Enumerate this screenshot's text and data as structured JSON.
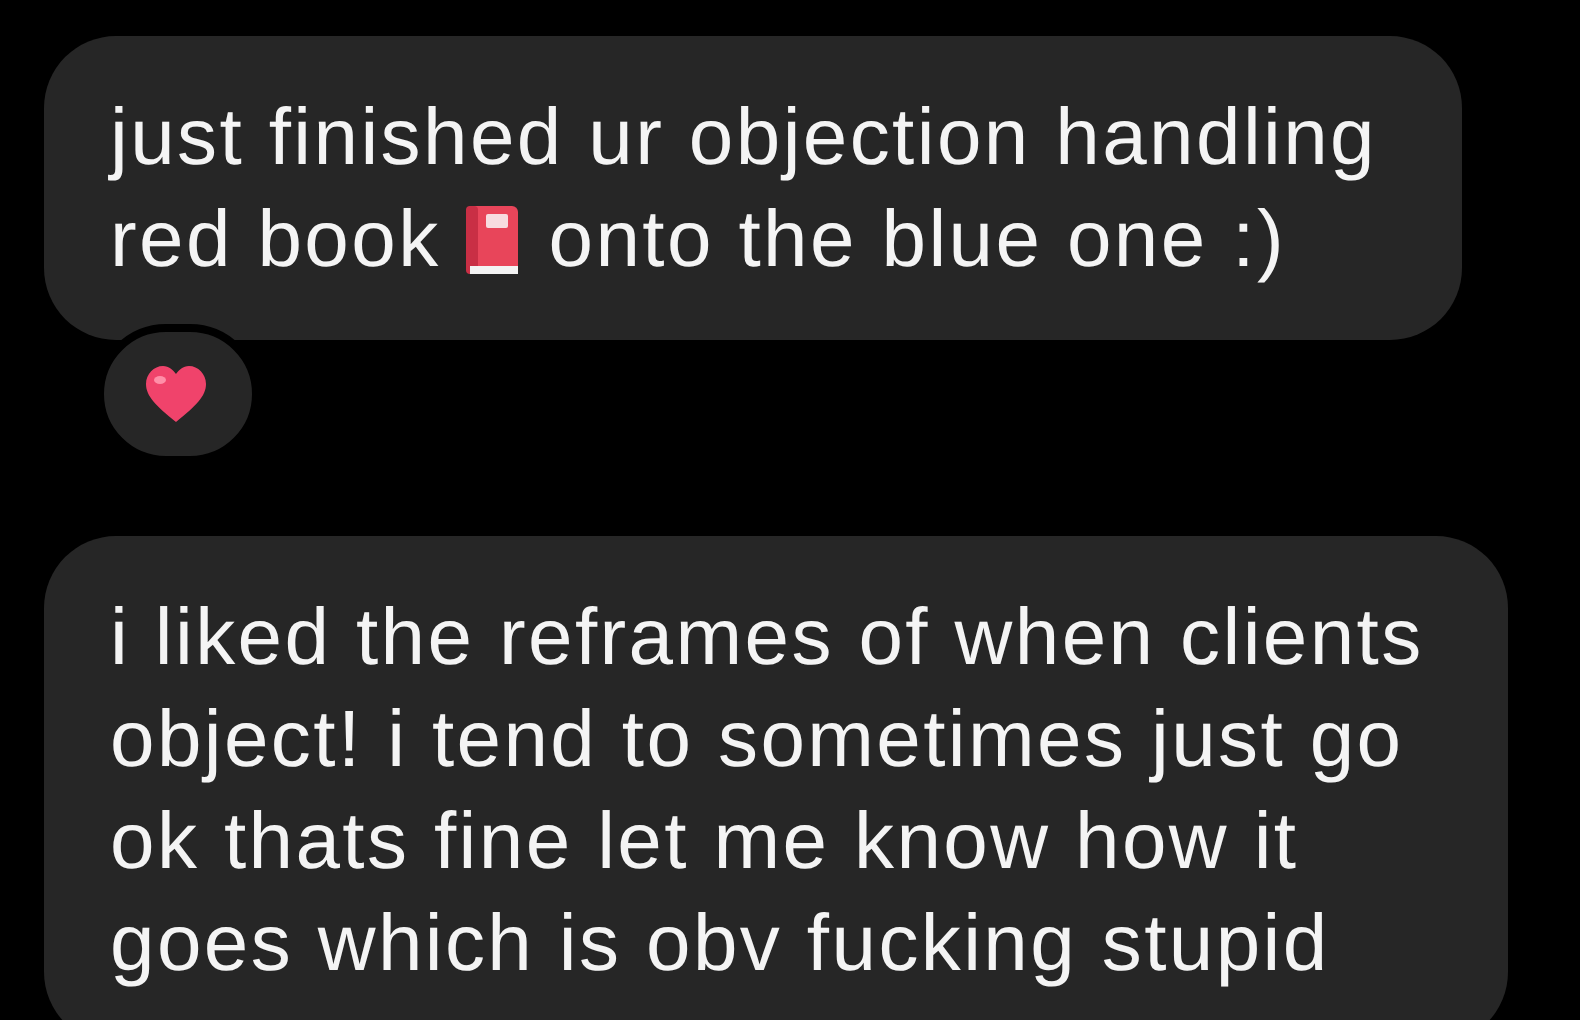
{
  "messages": [
    {
      "lines": [
        [
          {
            "kind": "text",
            "text": "just finished ur objection handling"
          }
        ],
        [
          {
            "kind": "text",
            "text": "red book"
          },
          {
            "kind": "book"
          },
          {
            "kind": "text",
            "text": "onto the blue one :)"
          }
        ]
      ],
      "reactions": [
        {
          "kind": "heart"
        }
      ]
    },
    {
      "lines": [
        [
          {
            "kind": "text",
            "text": "i liked the reframes of when clients"
          }
        ],
        [
          {
            "kind": "text",
            "text": "object! i tend to sometimes just go"
          }
        ],
        [
          {
            "kind": "text",
            "text": "ok thats fine let me know how it"
          }
        ],
        [
          {
            "kind": "text",
            "text": "goes which is obv fucking stupid"
          }
        ]
      ]
    }
  ]
}
